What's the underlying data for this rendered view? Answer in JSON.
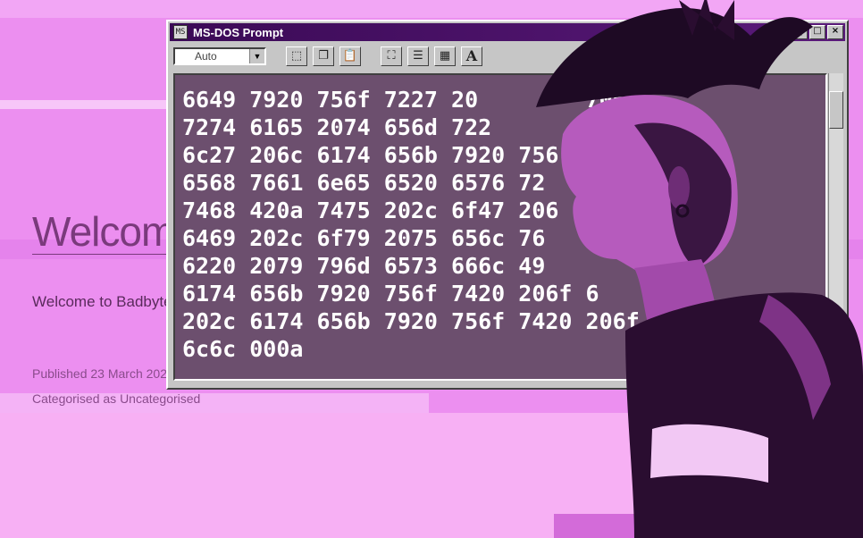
{
  "blog": {
    "title": "Welcome to Badbyte",
    "excerpt": "Welcome to Badbyte. The place whe… …/ hack the planet.",
    "published_label": "Published",
    "published_date": "23 March 2021",
    "categorised_label": "Categorised as",
    "category": "Uncategorised"
  },
  "dos_window": {
    "title": "MS-DOS Prompt",
    "font_select_value": "Auto",
    "buttons": {
      "minimize": "_",
      "maximize": "□",
      "close": "×",
      "font": "A"
    }
  },
  "console": {
    "lines": [
      "6649 7920 756f 7227 20        7061",
      "7274 6165 2074 656d 722       0a",
      "6c27 206c 6174 656b 7920 756      6f",
      "6568 7661 6e65 6520 6576 72       769",
      "7468 420a 7475 202c 6f47 206      6272",
      "6469 202c 6f79 2075 656c 76       656d",
      "6220 2079 796d 6573 666c 49       206c",
      "6174 656b 7920 756f 7420 206f 6    6c",
      "202c 6174 656b 7920 756f 7420 206f 65",
      "6c6c 000a"
    ]
  },
  "colors": {
    "background": "#ec8ff0",
    "titlebar": "#3b0a56",
    "console_bg": "#6c4f6e",
    "console_text": "#ffffff"
  }
}
